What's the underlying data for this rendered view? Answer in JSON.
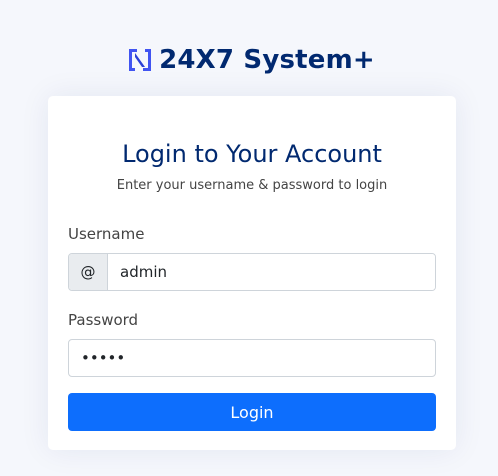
{
  "brand": {
    "name": "24X7 System+",
    "logo_icon": "brand-logo-icon",
    "color": "#012970",
    "logo_color": "#4154f1"
  },
  "login": {
    "title": "Login to Your Account",
    "subtitle": "Enter your username & password to login",
    "username_label": "Username",
    "username_prefix": "@",
    "username_value": "admin",
    "password_label": "Password",
    "password_value": "admin",
    "button_label": "Login",
    "button_color": "#0d6efd"
  }
}
